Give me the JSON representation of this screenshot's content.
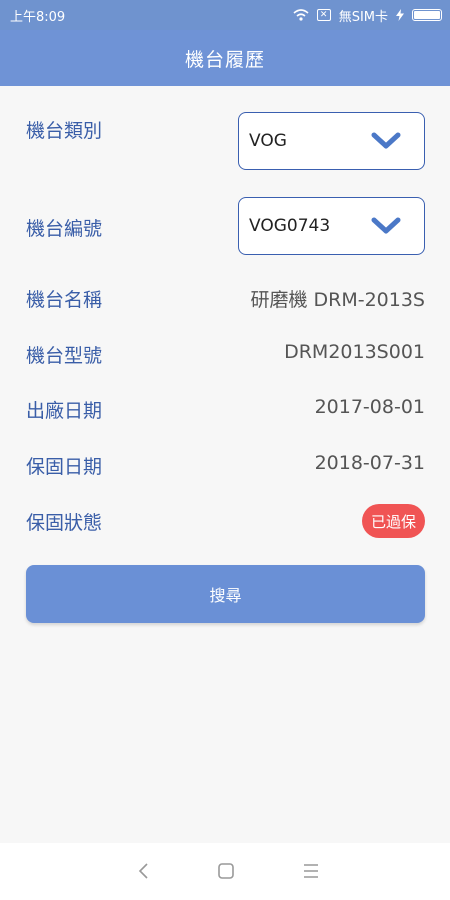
{
  "status_bar": {
    "time": "上午8:09",
    "sim_status": "無SIM卡",
    "sim_box_glyph": "✕"
  },
  "header": {
    "title": "機台履歷"
  },
  "form": {
    "machine_category": {
      "label": "機台類別",
      "value": "VOG"
    },
    "machine_number": {
      "label": "機台編號",
      "value": "VOG0743"
    },
    "machine_name": {
      "label": "機台名稱",
      "value": "研磨機 DRM-2013S"
    },
    "machine_model": {
      "label": "機台型號",
      "value": "DRM2013S001"
    },
    "ship_date": {
      "label": "出廠日期",
      "value": "2017-08-01"
    },
    "warranty_date": {
      "label": "保固日期",
      "value": "2018-07-31"
    },
    "warranty_status": {
      "label": "保固狀態",
      "badge": "已過保"
    }
  },
  "search_button": {
    "label": "搜尋"
  },
  "colors": {
    "header": "#6f93d6",
    "label": "#3a5ea8",
    "badge": "#f05454",
    "button": "#6a90d6"
  },
  "icons": [
    "wifi-icon",
    "sim-icon",
    "charging-icon",
    "battery-icon",
    "chevron-down-icon",
    "back-icon",
    "home-icon",
    "menu-icon"
  ]
}
